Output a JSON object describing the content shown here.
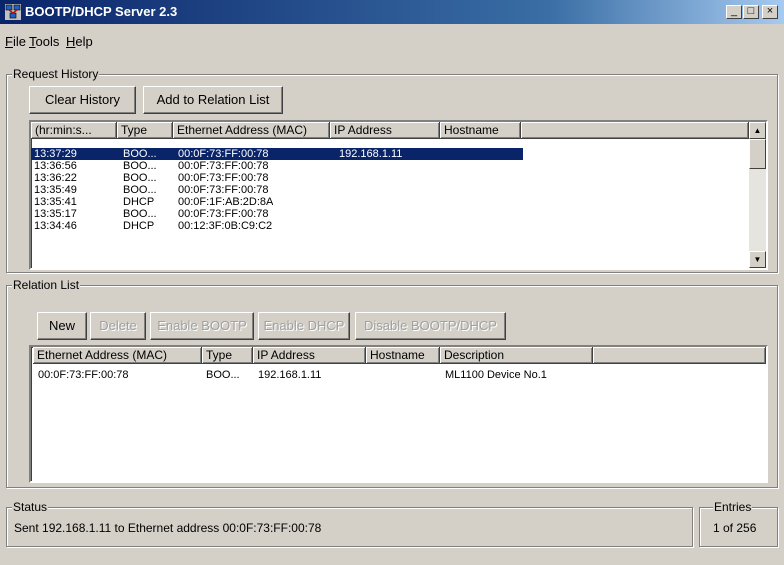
{
  "window": {
    "title": "BOOTP/DHCP Server 2.3",
    "controls": {
      "minimize": "_",
      "maximize": "□",
      "close": "×"
    }
  },
  "menu": [
    {
      "label": "File",
      "accel": "F",
      "rest": "ile"
    },
    {
      "label": "Tools",
      "accel": "T",
      "rest": "ools"
    },
    {
      "label": "Help",
      "accel": "H",
      "rest": "elp"
    }
  ],
  "request_history": {
    "label": "Request History",
    "buttons": {
      "clear": "Clear History",
      "add": "Add to Relation List"
    },
    "columns": [
      "(hr:min:s...",
      "Type",
      "Ethernet Address (MAC)",
      "IP Address",
      "Hostname"
    ],
    "rows": [
      {
        "time": "13:37:29",
        "type": "BOO...",
        "mac": "00:0F:73:FF:00:78",
        "ip": "192.168.1.11",
        "host": ""
      },
      {
        "time": "13:36:56",
        "type": "BOO...",
        "mac": "00:0F:73:FF:00:78",
        "ip": "",
        "host": ""
      },
      {
        "time": "13:36:22",
        "type": "BOO...",
        "mac": "00:0F:73:FF:00:78",
        "ip": "",
        "host": ""
      },
      {
        "time": "13:35:49",
        "type": "BOO...",
        "mac": "00:0F:73:FF:00:78",
        "ip": "",
        "host": ""
      },
      {
        "time": "13:35:41",
        "type": "DHCP",
        "mac": "00:0F:1F:AB:2D:8A",
        "ip": "",
        "host": ""
      },
      {
        "time": "13:35:17",
        "type": "BOO...",
        "mac": "00:0F:73:FF:00:78",
        "ip": "",
        "host": ""
      },
      {
        "time": "13:34:46",
        "type": "DHCP",
        "mac": "00:12:3F:0B:C9:C2",
        "ip": "",
        "host": ""
      }
    ],
    "scroll": {
      "up": "▲",
      "down": "▼"
    }
  },
  "relation_list": {
    "label": "Relation List",
    "buttons": {
      "new": "New",
      "delete": "Delete",
      "enable_bootp": "Enable BOOTP",
      "enable_dhcp": "Enable DHCP",
      "disable": "Disable BOOTP/DHCP"
    },
    "columns": [
      "Ethernet Address (MAC)",
      "Type",
      "IP Address",
      "Hostname",
      "Description"
    ],
    "rows": [
      {
        "mac": "00:0F:73:FF:00:78",
        "type": "BOO...",
        "ip": "192.168.1.11",
        "host": "",
        "desc": "ML1100 Device No.1"
      }
    ]
  },
  "status": {
    "label": "Status",
    "text": "Sent 192.168.1.11 to Ethernet address 00:0F:73:FF:00:78"
  },
  "entries": {
    "label": "Entries",
    "text": "1 of 256"
  }
}
